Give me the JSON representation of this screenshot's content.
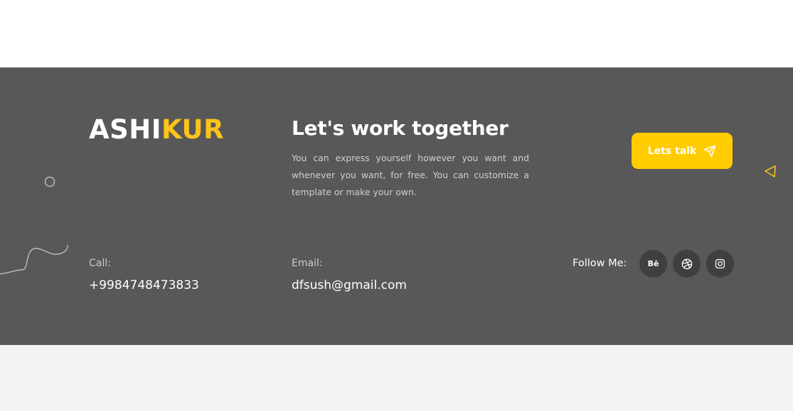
{
  "brand": {
    "logo_part1": "ASHI",
    "logo_part2": "KUR",
    "accent_color": "#fcc419",
    "footer_background": "#585858"
  },
  "cta_section": {
    "headline": "Let's work together",
    "description": "You can express yourself however you want and whenever you want, for free. You can customize a template or make your own.",
    "button_label": "Lets talk",
    "button_icon": "send-icon",
    "button_color": "#ffcc00"
  },
  "contact": {
    "call_label": "Call:",
    "call_value": "+9984748473833",
    "email_label": "Email:",
    "email_value": "dfsush@gmail.com"
  },
  "social": {
    "label": "Follow Me:",
    "items": [
      {
        "name": "behance",
        "icon": "behance-icon",
        "text": "Bē"
      },
      {
        "name": "dribbble",
        "icon": "dribbble-icon"
      },
      {
        "name": "instagram",
        "icon": "instagram-icon"
      }
    ]
  }
}
